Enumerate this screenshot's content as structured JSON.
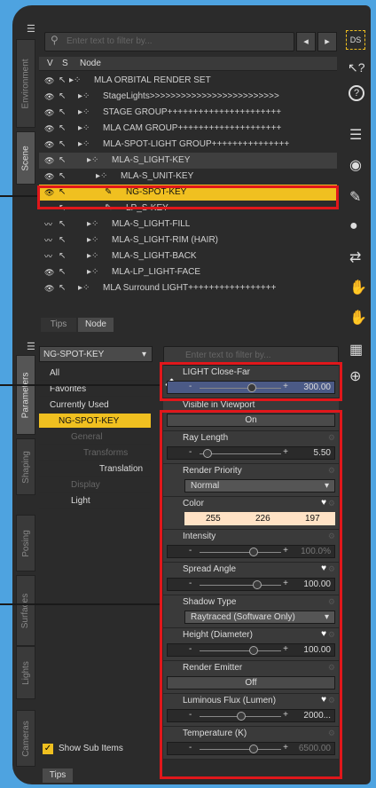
{
  "scene_panel": {
    "search_placeholder": "Enter text to filter by...",
    "col_v": "V",
    "col_s": "S",
    "col_node": "Node",
    "rows": [
      {
        "label": "MLA ORBITAL RENDER SET",
        "indent": 0
      },
      {
        "label": "StageLights>>>>>>>>>>>>>>>>>>>>>>>>>",
        "indent": 1
      },
      {
        "label": "STAGE GROUP++++++++++++++++++++++",
        "indent": 1
      },
      {
        "label": "MLA CAM GROUP++++++++++++++++++++",
        "indent": 1
      },
      {
        "label": "MLA-SPOT-LIGHT GROUP+++++++++++++++",
        "indent": 1
      },
      {
        "label": "MLA-S_LIGHT-KEY",
        "indent": 2
      },
      {
        "label": "MLA-S_UNIT-KEY",
        "indent": 3
      },
      {
        "label": "NG-SPOT-KEY",
        "indent": 4
      },
      {
        "label": "LP_S-KEY",
        "indent": 4
      },
      {
        "label": "MLA-S_LIGHT-FILL",
        "indent": 2
      },
      {
        "label": "MLA-S_LIGHT-RIM (HAIR)",
        "indent": 2
      },
      {
        "label": "MLA-S_LIGHT-BACK",
        "indent": 2
      },
      {
        "label": "MLA-LP_LIGHT-FACE",
        "indent": 2
      },
      {
        "label": "MLA Surround LIGHT+++++++++++++++++",
        "indent": 1
      }
    ],
    "bottom_tabs": [
      "Tips",
      "Node"
    ]
  },
  "left_tabs_top": [
    "Environment",
    "Scene"
  ],
  "left_tabs_bottom": [
    "Parameters",
    "Shaping",
    "Posing",
    "Surfaces",
    "Lights",
    "Cameras"
  ],
  "params": {
    "node_select": "NG-SPOT-KEY",
    "search_placeholder": "Enter text to filter by...",
    "categories": [
      "All",
      "Favorites",
      "Currently Used",
      "NG-SPOT-KEY",
      "General",
      "Transforms",
      "Translation",
      "Display",
      "Light"
    ],
    "show_sub_items": "Show Sub Items",
    "bottom_tab": "Tips",
    "light_close_far": {
      "label": "LIGHT Close-Far",
      "value": "300.00"
    },
    "visible_viewport": {
      "label": "Visible in Viewport",
      "value": "On"
    },
    "ray_length": {
      "label": "Ray Length",
      "value": "5.50"
    },
    "render_priority": {
      "label": "Render Priority",
      "value": "Normal"
    },
    "color": {
      "label": "Color",
      "r": "255",
      "g": "226",
      "b": "197",
      "swatch": "#ffe2c5"
    },
    "intensity": {
      "label": "Intensity",
      "value": "100.0%"
    },
    "spread_angle": {
      "label": "Spread Angle",
      "value": "100.00"
    },
    "shadow_type": {
      "label": "Shadow Type",
      "value": "Raytraced (Software Only)"
    },
    "height": {
      "label": "Height (Diameter)",
      "value": "100.00"
    },
    "render_emitter": {
      "label": "Render Emitter",
      "value": "Off"
    },
    "luminous_flux": {
      "label": "Luminous Flux (Lumen)",
      "value": "2000..."
    },
    "temperature": {
      "label": "Temperature (K)",
      "value": "6500.00"
    }
  },
  "toolbar": {
    "ds_label": "DS",
    "help_label": "?"
  },
  "colors": {
    "highlight": "#f0c020",
    "annotation": "#e0171b"
  }
}
